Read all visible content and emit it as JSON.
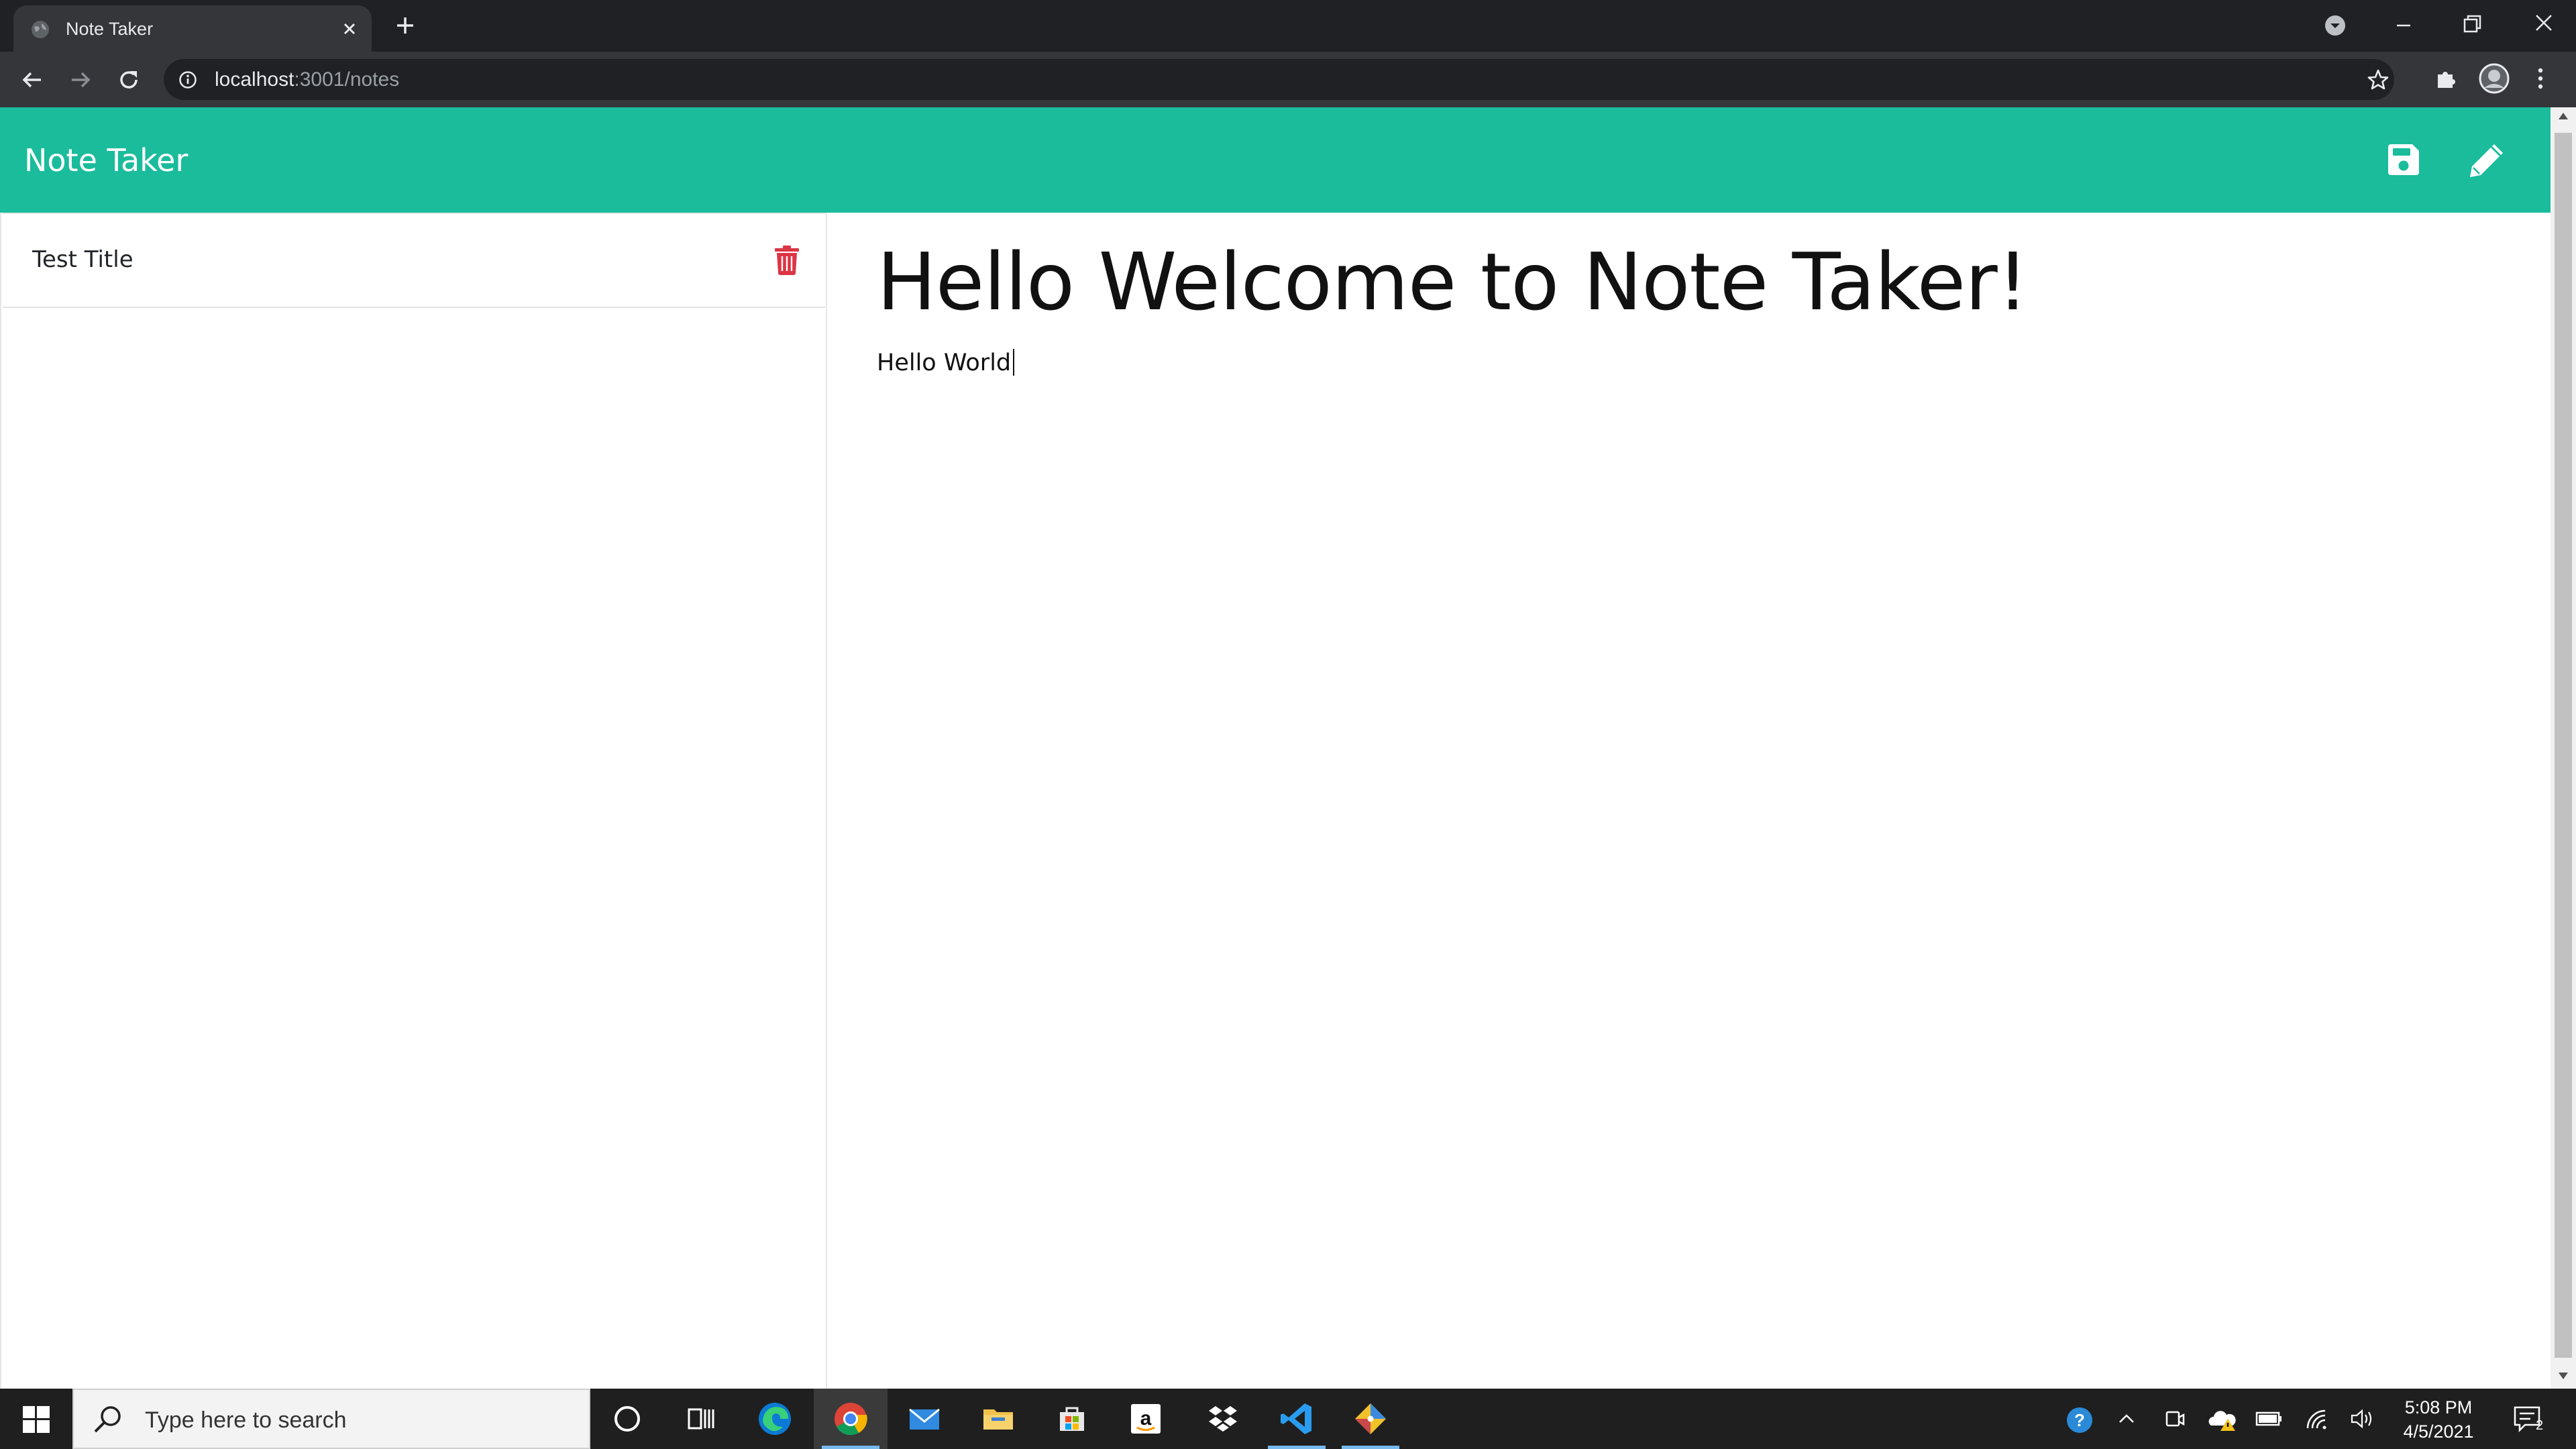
{
  "browser": {
    "tab_title": "Note Taker",
    "url_host": "localhost",
    "url_path": ":3001/notes"
  },
  "app": {
    "brand": "Note Taker"
  },
  "notes": [
    {
      "title": "Test Title"
    }
  ],
  "editor": {
    "title": "Hello Welcome to Note Taker!",
    "body": "Hello World"
  },
  "colors": {
    "navbar": "#1abc9c",
    "delete_icon": "#dc3545",
    "taskbar": "#1f1f1f"
  },
  "taskbar": {
    "search_placeholder": "Type here to search",
    "time": "5:08 PM",
    "date": "4/5/2021",
    "notification_count": "2",
    "apps": [
      "cortana-icon",
      "task-view-icon",
      "edge-icon",
      "chrome-icon",
      "mail-icon",
      "file-explorer-icon",
      "store-icon",
      "amazon-icon",
      "dropbox-icon",
      "vscode-icon",
      "git-icon"
    ]
  }
}
